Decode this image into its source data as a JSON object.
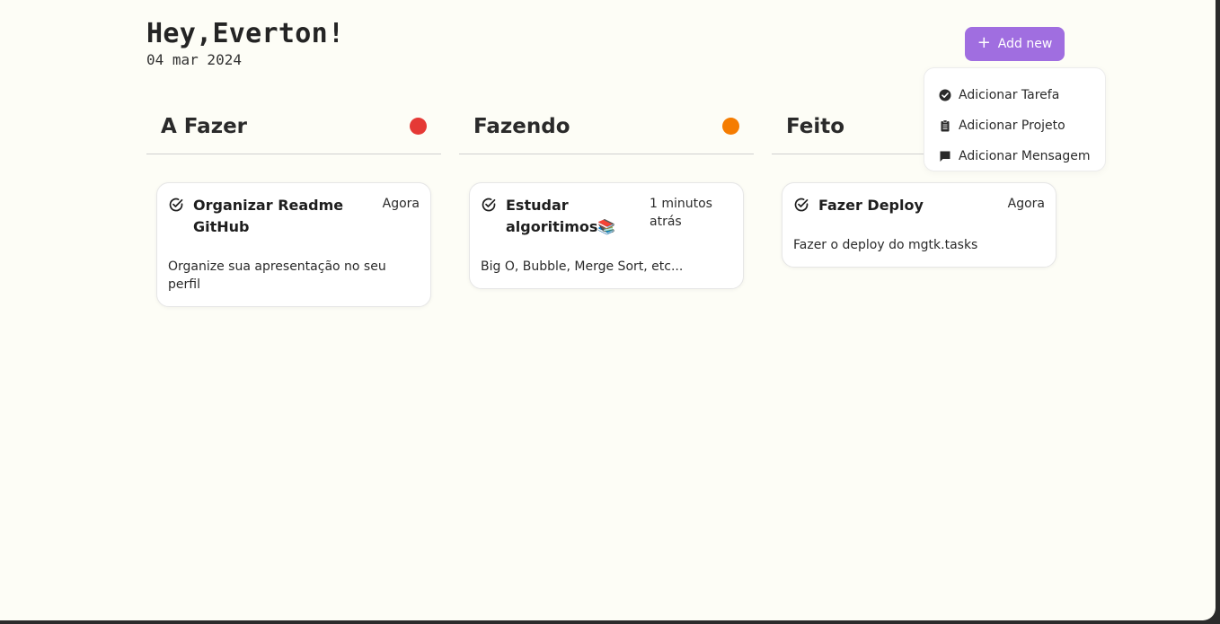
{
  "header": {
    "greeting": "Hey,Everton!",
    "date": "04 mar 2024",
    "add_button_label": "Add new"
  },
  "add_menu": {
    "items": [
      {
        "label": "Adicionar Tarefa",
        "icon": "check-circle-icon"
      },
      {
        "label": "Adicionar Projeto",
        "icon": "clipboard-icon"
      },
      {
        "label": "Adicionar Mensagem",
        "icon": "message-icon"
      }
    ]
  },
  "columns": [
    {
      "title": "A Fazer",
      "dot_color": "#e53935",
      "cards": [
        {
          "title": "Organizar Readme GitHub",
          "time": "Agora",
          "description": "Organize sua apresentação no seu perfil"
        }
      ]
    },
    {
      "title": "Fazendo",
      "dot_color": "#f57c00",
      "cards": [
        {
          "title": "Estudar algoritimos📚",
          "time": "1 minutos atrás",
          "description": "Big O, Bubble, Merge Sort, etc..."
        }
      ]
    },
    {
      "title": "Feito",
      "dot_color": "#43a047",
      "cards": [
        {
          "title": "Fazer Deploy",
          "time": "Agora",
          "description": "Fazer o deploy do mgtk.tasks"
        }
      ]
    }
  ],
  "colors": {
    "background": "#fdfdf6",
    "accent": "#a06ee0",
    "text": "#2a2a2a"
  }
}
